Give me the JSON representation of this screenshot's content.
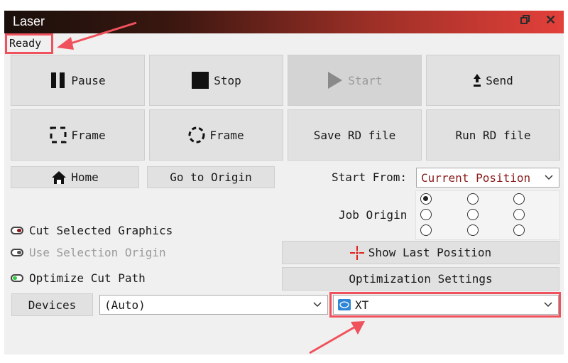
{
  "window": {
    "title": "Laser",
    "restore_icon": "restore-window-icon",
    "close_icon": "close-icon"
  },
  "status": "Ready",
  "buttons": {
    "pause": "Pause",
    "stop": "Stop",
    "start": "Start",
    "send": "Send",
    "frame_rect": "Frame",
    "frame_circle": "Frame",
    "save_rd": "Save RD file",
    "run_rd": "Run RD file",
    "home": "Home",
    "go_origin": "Go to Origin",
    "show_last_position": "Show Last Position",
    "optimization_settings": "Optimization Settings",
    "devices": "Devices"
  },
  "start_from": {
    "label": "Start From:",
    "value": "Current Position"
  },
  "job_origin": {
    "label": "Job Origin",
    "selected": "top-left"
  },
  "options": [
    {
      "label": "Cut Selected Graphics",
      "state": "off",
      "color": "#8b1a1a"
    },
    {
      "label": "Use Selection Origin",
      "state": "disabled",
      "color": "#555555"
    },
    {
      "label": "Optimize Cut Path",
      "state": "on",
      "color": "#2ecc40"
    }
  ],
  "port_select": {
    "value": "(Auto)"
  },
  "device_select": {
    "value": "XT",
    "icon": "device-icon"
  },
  "colors": {
    "highlight": "#f0525d",
    "start_from_value": "#8b1a1a"
  }
}
